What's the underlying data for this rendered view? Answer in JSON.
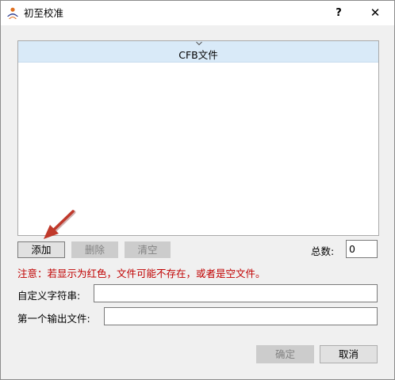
{
  "window": {
    "title": "初至校准",
    "help_symbol": "?",
    "close_symbol": "✕",
    "app_icon": "person-logo-icon"
  },
  "file_list": {
    "column_header": "CFB文件",
    "rows": []
  },
  "buttons": {
    "add": "添加",
    "delete": "删除",
    "clear": "清空",
    "ok": "确定",
    "cancel": "取消"
  },
  "total": {
    "label": "总数:",
    "value": "0"
  },
  "notice": "注意：若显示为红色，文件可能不存在，或者是空文件。",
  "fields": {
    "alias_label": "自定义字符串:",
    "alias_value": "",
    "output_label": "第一个输出文件:",
    "output_value": ""
  },
  "colors": {
    "warning_text": "#c00000",
    "list_header_bg": "#d9eaf8",
    "annotation_arrow": "#c0392b"
  }
}
